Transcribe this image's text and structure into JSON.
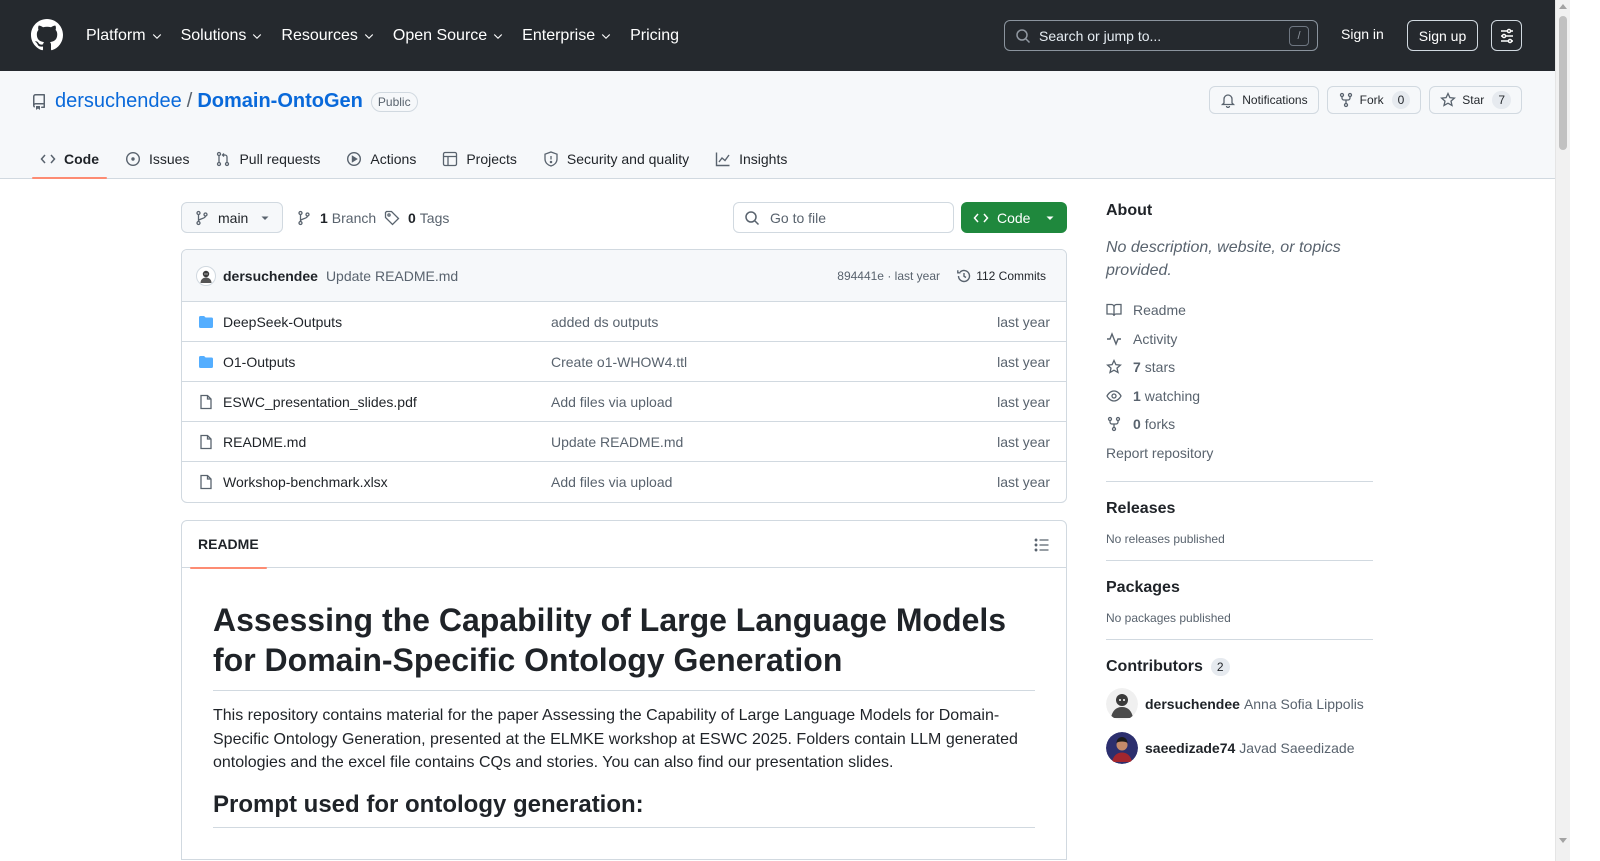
{
  "header": {
    "nav": [
      {
        "label": "Platform",
        "dropdown": true
      },
      {
        "label": "Solutions",
        "dropdown": true
      },
      {
        "label": "Resources",
        "dropdown": true
      },
      {
        "label": "Open Source",
        "dropdown": true
      },
      {
        "label": "Enterprise",
        "dropdown": true
      },
      {
        "label": "Pricing",
        "dropdown": false
      }
    ],
    "search_placeholder": "Search or jump to...",
    "search_shortcut": "/",
    "signin_label": "Sign in",
    "signup_label": "Sign up",
    "icons": {
      "logo": "github-logo-icon",
      "search": "search-icon",
      "menu": "sliders-icon"
    }
  },
  "repo": {
    "owner": "dersuchendee",
    "separator": "/",
    "name": "Domain-OntoGen",
    "visibility": "Public",
    "notifications_label": "Notifications",
    "fork_label": "Fork",
    "fork_count": "0",
    "star_label": "Star",
    "star_count": "7"
  },
  "tabs": [
    {
      "label": "Code",
      "icon": "code-icon",
      "active": true
    },
    {
      "label": "Issues",
      "icon": "issue-icon",
      "active": false
    },
    {
      "label": "Pull requests",
      "icon": "pull-request-icon",
      "active": false
    },
    {
      "label": "Actions",
      "icon": "play-icon",
      "active": false
    },
    {
      "label": "Projects",
      "icon": "table-icon",
      "active": false
    },
    {
      "label": "Security and quality",
      "icon": "shield-icon",
      "active": false
    },
    {
      "label": "Insights",
      "icon": "graph-icon",
      "active": false
    }
  ],
  "toolbar": {
    "branch": "main",
    "branch_count": "1",
    "branch_label": "Branch",
    "tag_count": "0",
    "tag_label": "Tags",
    "goto_placeholder": "Go to file",
    "code_label": "Code"
  },
  "commit": {
    "author": "dersuchendee",
    "message": "Update README.md",
    "meta": "894441e · last year",
    "count_label": "112 Commits"
  },
  "files": [
    {
      "type": "dir",
      "name": "DeepSeek-Outputs",
      "message": "added ds outputs",
      "time": "last year"
    },
    {
      "type": "dir",
      "name": "O1-Outputs",
      "message": "Create o1-WHOW4.ttl",
      "time": "last year"
    },
    {
      "type": "file",
      "name": "ESWC_presentation_slides.pdf",
      "message": "Add files via upload",
      "time": "last year"
    },
    {
      "type": "file",
      "name": "README.md",
      "message": "Update README.md",
      "time": "last year"
    },
    {
      "type": "file",
      "name": "Workshop-benchmark.xlsx",
      "message": "Add files via upload",
      "time": "last year"
    }
  ],
  "readme": {
    "tab_label": "README",
    "title": "Assessing the Capability of Large Language Models for Domain-Specific Ontology Generation",
    "paragraph": "This repository contains material for the paper Assessing the Capability of Large Language Models for Domain-Specific Ontology Generation, presented at the ELMKE workshop at ESWC 2025. Folders contain LLM generated ontologies and the excel file contains CQs and stories. You can also find our presentation slides.",
    "subtitle": "Prompt used for ontology generation:"
  },
  "about": {
    "title": "About",
    "description": "No description, website, or topics provided.",
    "links": [
      {
        "icon": "book-icon",
        "count": "",
        "label": "Readme"
      },
      {
        "icon": "pulse-icon",
        "count": "",
        "label": "Activity"
      },
      {
        "icon": "star-icon",
        "count": "7",
        "label": "stars"
      },
      {
        "icon": "eye-icon",
        "count": "1",
        "label": "watching"
      },
      {
        "icon": "fork-icon",
        "count": "0",
        "label": "forks"
      }
    ],
    "report_label": "Report repository"
  },
  "releases": {
    "title": "Releases",
    "empty": "No releases published"
  },
  "packages": {
    "title": "Packages",
    "empty": "No packages published"
  },
  "contributors": {
    "title": "Contributors",
    "count": "2",
    "people": [
      {
        "login": "dersuchendee",
        "name": "Anna Sofia Lippolis"
      },
      {
        "login": "saeedizade74",
        "name": "Javad Saeedizade"
      }
    ]
  },
  "colors": {
    "header_bg": "#25292e",
    "link": "#0969da",
    "primary_button": "#1f883d",
    "active_tab_underline": "#fd8c73",
    "folder_icon": "#54aeff"
  }
}
